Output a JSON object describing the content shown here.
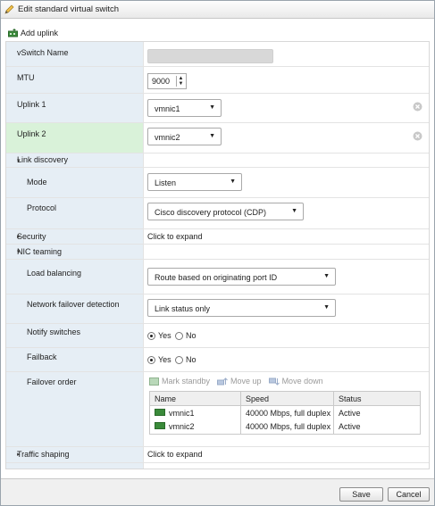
{
  "title": "Edit standard virtual switch",
  "toolbar": {
    "add_uplink": "Add uplink"
  },
  "vswitch_name": {
    "label": "vSwitch Name",
    "value": ""
  },
  "mtu": {
    "label": "MTU",
    "value": "9000"
  },
  "uplink1": {
    "label": "Uplink 1",
    "value": "vmnic1"
  },
  "uplink2": {
    "label": "Uplink 2",
    "value": "vmnic2"
  },
  "link_discovery": {
    "label": "Link discovery",
    "mode": {
      "label": "Mode",
      "value": "Listen"
    },
    "protocol": {
      "label": "Protocol",
      "value": "Cisco discovery protocol (CDP)"
    }
  },
  "security": {
    "label": "Security",
    "value": "Click to expand"
  },
  "nic_teaming": {
    "label": "NIC teaming",
    "load_balancing": {
      "label": "Load balancing",
      "value": "Route based on originating port ID"
    },
    "failover_detection": {
      "label": "Network failover detection",
      "value": "Link status only"
    },
    "notify_switches": {
      "label": "Notify switches",
      "yes": "Yes",
      "no": "No",
      "selected": "Yes"
    },
    "failback": {
      "label": "Failback",
      "yes": "Yes",
      "no": "No",
      "selected": "Yes"
    },
    "failover_order": {
      "label": "Failover order",
      "tools": [
        "Mark standby",
        "Move up",
        "Move down"
      ],
      "columns": [
        "Name",
        "Speed",
        "Status"
      ],
      "rows": [
        {
          "name": "vmnic1",
          "speed": "40000 Mbps, full duplex",
          "status": "Active"
        },
        {
          "name": "vmnic2",
          "speed": "40000 Mbps, full duplex",
          "status": "Active"
        }
      ]
    }
  },
  "traffic_shaping": {
    "label": "Traffic shaping",
    "value": "Click to expand"
  },
  "footer": {
    "save": "Save",
    "cancel": "Cancel"
  },
  "colors": {
    "label_bg": "#e6eef5",
    "highlight_bg": "#d9f2d9",
    "nic_green": "#3a8a3a"
  }
}
